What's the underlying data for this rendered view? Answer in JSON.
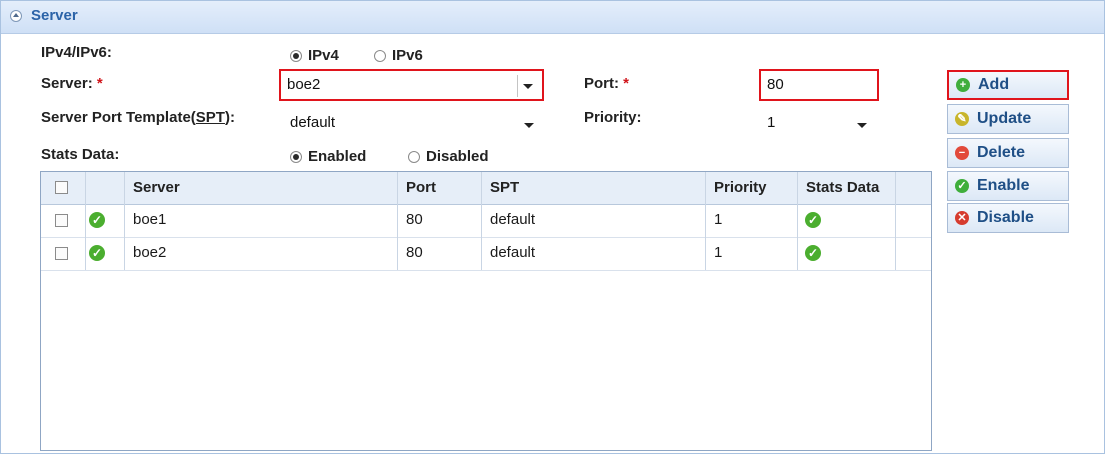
{
  "panel": {
    "title": "Server"
  },
  "form": {
    "ipversion_label": "IPv4/IPv6:",
    "ipv4_label": "IPv4",
    "ipv6_label": "IPv6",
    "ipversion_selected": "IPv4",
    "server_label": "Server:",
    "server_value": "boe2",
    "port_label": "Port:",
    "port_value": "80",
    "required_mark": "*",
    "spt_label_prefix": "Server Port Template(",
    "spt_label_abbr": "SPT",
    "spt_label_suffix": "):",
    "spt_value": "default",
    "priority_label": "Priority:",
    "priority_value": "1",
    "stats_label": "Stats Data:",
    "stats_enabled_label": "Enabled",
    "stats_disabled_label": "Disabled",
    "stats_selected": "Enabled"
  },
  "buttons": {
    "add": "Add",
    "update": "Update",
    "delete": "Delete",
    "enable": "Enable",
    "disable": "Disable"
  },
  "table": {
    "columns": [
      "Server",
      "Port",
      "SPT",
      "Priority",
      "Stats Data"
    ],
    "rows": [
      {
        "server": "boe1",
        "port": "80",
        "spt": "default",
        "priority": "1",
        "stats": "enabled",
        "status": "enabled"
      },
      {
        "server": "boe2",
        "port": "80",
        "spt": "default",
        "priority": "1",
        "stats": "enabled",
        "status": "enabled"
      }
    ]
  },
  "colors": {
    "accent": "#2b63a8",
    "highlight_border": "#e0141c",
    "ok_green": "#4bae2f",
    "add_icon": "#3fae3c",
    "update_icon": "#c8b52b",
    "delete_icon": "#e24a3b",
    "enable_icon": "#3fae3c",
    "disable_icon": "#d63c2f"
  },
  "icons": {
    "collapse": "collapse-up-icon",
    "add": "plus-circle-icon",
    "update": "pencil-icon",
    "delete": "minus-circle-icon",
    "enable": "check-circle-icon",
    "disable": "x-circle-icon",
    "row_status": "check-circle-icon"
  }
}
